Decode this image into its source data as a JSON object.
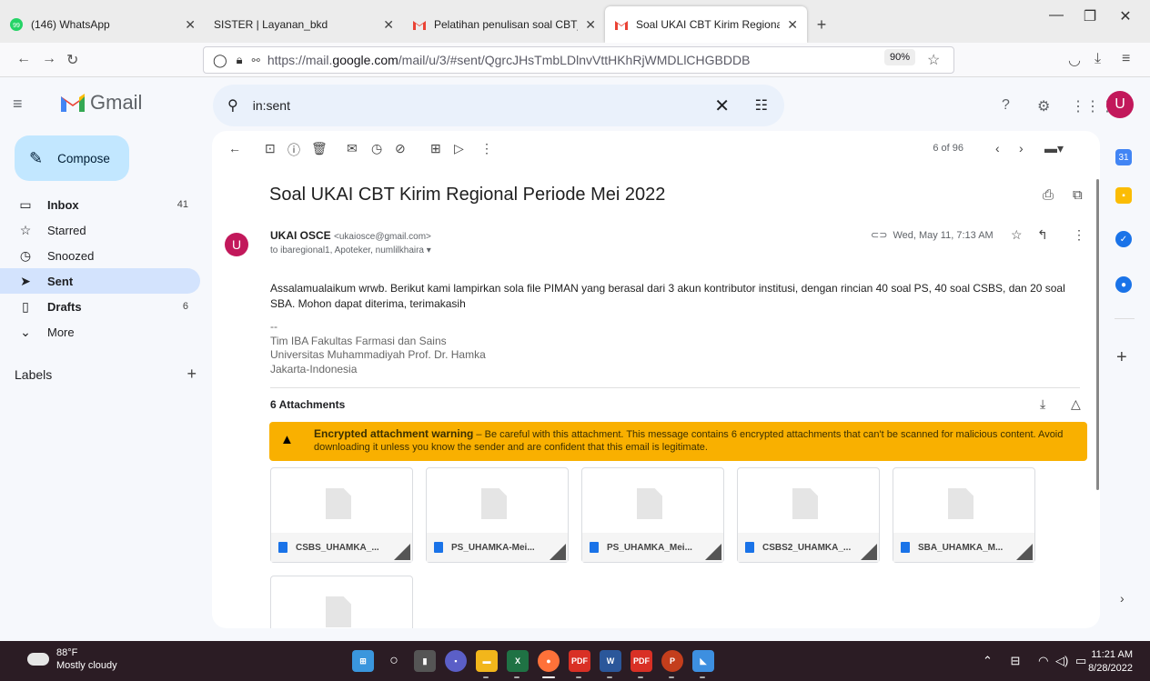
{
  "browser": {
    "tabs": [
      {
        "label": "(146) WhatsApp",
        "favicon": "whatsapp-icon"
      },
      {
        "label": "SISTER | Layanan_bkd",
        "favicon": "none"
      },
      {
        "label": "Pelatihan penulisan soal CBT_N",
        "favicon": "gmail-icon"
      },
      {
        "label": "Soal UKAI CBT Kirim Regional P",
        "favicon": "gmail-icon",
        "active": true
      }
    ],
    "url_prefix": "https://mail.",
    "url_domain": "google.com",
    "url_path": "/mail/u/3/#sent/QgrcJHsTmbLDlnvVttHKhRjWMDLlCHGBDDB",
    "zoom": "90%"
  },
  "gmail": {
    "logo_text": "Gmail",
    "search_value": "in:sent",
    "avatar_letter": "U",
    "compose_label": "Compose",
    "nav": [
      {
        "label": "Inbox",
        "count": "41",
        "icon": "inbox-icon",
        "bold": true
      },
      {
        "label": "Starred",
        "count": "",
        "icon": "star-icon"
      },
      {
        "label": "Snoozed",
        "count": "",
        "icon": "clock-icon"
      },
      {
        "label": "Sent",
        "count": "",
        "icon": "send-icon",
        "active": true
      },
      {
        "label": "Drafts",
        "count": "6",
        "icon": "draft-icon",
        "bold": true
      },
      {
        "label": "More",
        "count": "",
        "icon": "chevron-down-icon"
      }
    ],
    "labels_heading": "Labels",
    "pager": "6 of 96"
  },
  "email": {
    "subject": "Soal UKAI CBT Kirim Regional Periode Mei 2022",
    "sender_avatar": "U",
    "sender_name": "UKAI OSCE",
    "sender_email": "<ukaiosce@gmail.com>",
    "recipients": "to ibaregional1, Apoteker, numlilkhaira",
    "date": "Wed, May 11, 7:13 AM",
    "body": "Assalamualaikum wrwb. Berikut kami lampirkan sola file PIMAN yang berasal dari 3 akun kontributor institusi, dengan rincian 40 soal PS, 40 soal CSBS, dan 20 soal SBA. Mohon dapat diterima, terimakasih",
    "sig_dash": "--",
    "sig_line1": "Tim IBA Fakultas Farmasi dan Sains",
    "sig_line2": "Universitas Muhammadiyah Prof. Dr. Hamka",
    "sig_line3": "Jakarta-Indonesia",
    "attachments_heading": "6 Attachments",
    "warning_title": "Encrypted attachment warning",
    "warning_text": " – Be careful with this attachment. This message contains 6 encrypted attachments that can't be scanned for malicious content. Avoid downloading it unless you know the sender and are confident that this email is legitimate.",
    "attachments": [
      "CSBS_UHAMKA_...",
      "PS_UHAMKA-Mei...",
      "PS_UHAMKA_Mei...",
      "CSBS2_UHAMKA_...",
      "SBA_UHAMKA_M...",
      ""
    ]
  },
  "taskbar": {
    "temp": "88°F",
    "weather": "Mostly cloudy",
    "time": "11:21 AM",
    "date": "8/28/2022"
  }
}
